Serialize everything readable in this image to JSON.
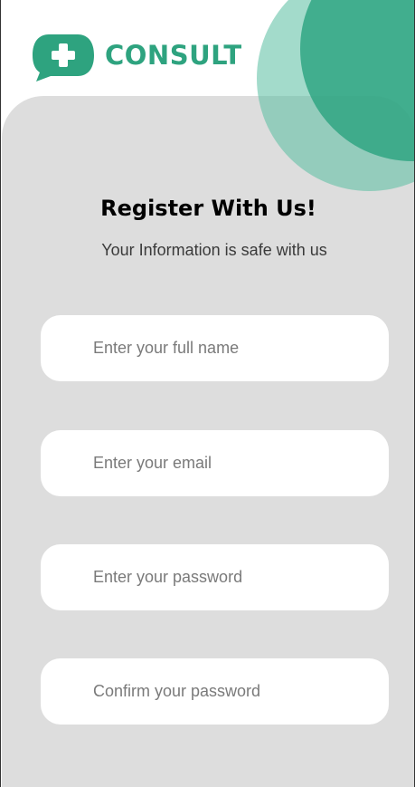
{
  "brand": {
    "name": "CONSULT",
    "color": "#2ea37f"
  },
  "header": {
    "title": "Register With Us!",
    "subtitle": "Your Information is safe with us"
  },
  "form": {
    "full_name": {
      "placeholder": "Enter your full name",
      "value": ""
    },
    "email": {
      "placeholder": "Enter your email",
      "value": ""
    },
    "password": {
      "placeholder": "Enter your password",
      "value": ""
    },
    "confirm_password": {
      "placeholder": "Confirm your password",
      "value": ""
    }
  },
  "colors": {
    "panel_background": "#dddddd",
    "accent_dark": "#2ca380",
    "accent_light": "#58bea0",
    "field_background": "#ffffff"
  },
  "icons": {
    "logo": "speech-bubble-plus-icon"
  }
}
